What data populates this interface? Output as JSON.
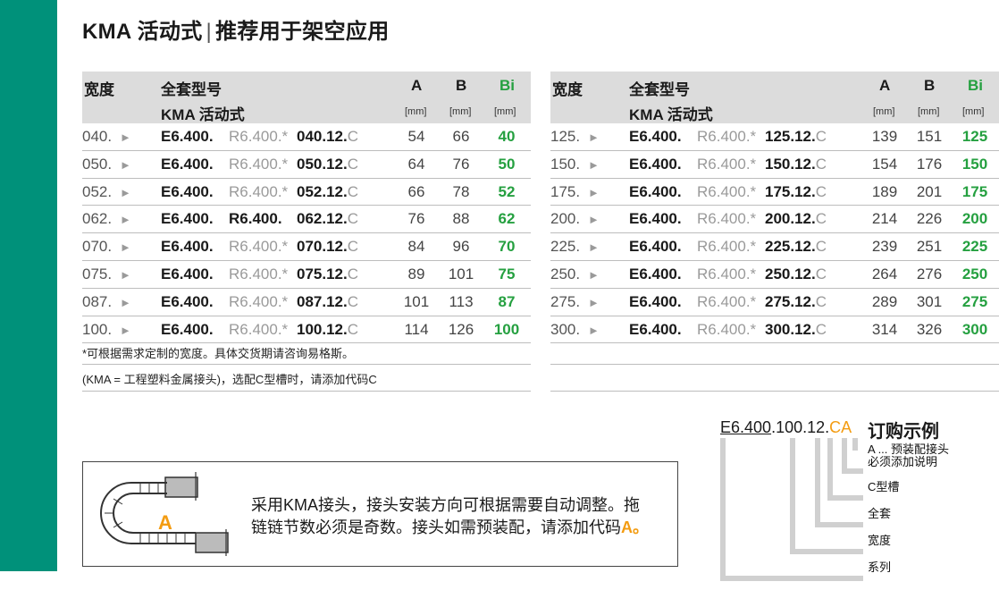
{
  "title": {
    "main": "KMA 活动式",
    "sep": "|",
    "sub": "推荐用于架空应用"
  },
  "headers": {
    "width": "宽度",
    "model": "全套型号",
    "model_sub": "KMA 活动式",
    "a": "A",
    "b": "B",
    "bi": "Bi",
    "unit": "[mm]"
  },
  "arrow": "►",
  "rows_left": [
    {
      "w": "040.",
      "e": "E6.400.",
      "r": "R6.400.*",
      "n": "040.12.",
      "c": "C",
      "a": "54",
      "b": "66",
      "bi": "40"
    },
    {
      "w": "050.",
      "e": "E6.400.",
      "r": "R6.400.*",
      "n": "050.12.",
      "c": "C",
      "a": "64",
      "b": "76",
      "bi": "50"
    },
    {
      "w": "052.",
      "e": "E6.400.",
      "r": "R6.400.*",
      "n": "052.12.",
      "c": "C",
      "a": "66",
      "b": "78",
      "bi": "52"
    },
    {
      "w": "062.",
      "e": "E6.400.",
      "r": "R6.400.",
      "n": "062.12.",
      "c": "C",
      "a": "76",
      "b": "88",
      "bi": "62"
    },
    {
      "w": "070.",
      "e": "E6.400.",
      "r": "R6.400.*",
      "n": "070.12.",
      "c": "C",
      "a": "84",
      "b": "96",
      "bi": "70"
    },
    {
      "w": "075.",
      "e": "E6.400.",
      "r": "R6.400.*",
      "n": "075.12.",
      "c": "C",
      "a": "89",
      "b": "101",
      "bi": "75"
    },
    {
      "w": "087.",
      "e": "E6.400.",
      "r": "R6.400.*",
      "n": "087.12.",
      "c": "C",
      "a": "101",
      "b": "113",
      "bi": "87"
    },
    {
      "w": "100.",
      "e": "E6.400.",
      "r": "R6.400.*",
      "n": "100.12.",
      "c": "C",
      "a": "114",
      "b": "126",
      "bi": "100"
    }
  ],
  "rows_right": [
    {
      "w": "125.",
      "e": "E6.400.",
      "r": "R6.400.*",
      "n": "125.12.",
      "c": "C",
      "a": "139",
      "b": "151",
      "bi": "125"
    },
    {
      "w": "150.",
      "e": "E6.400.",
      "r": "R6.400.*",
      "n": "150.12.",
      "c": "C",
      "a": "154",
      "b": "176",
      "bi": "150"
    },
    {
      "w": "175.",
      "e": "E6.400.",
      "r": "R6.400.*",
      "n": "175.12.",
      "c": "C",
      "a": "189",
      "b": "201",
      "bi": "175"
    },
    {
      "w": "200.",
      "e": "E6.400.",
      "r": "R6.400.*",
      "n": "200.12.",
      "c": "C",
      "a": "214",
      "b": "226",
      "bi": "200"
    },
    {
      "w": "225.",
      "e": "E6.400.",
      "r": "R6.400.*",
      "n": "225.12.",
      "c": "C",
      "a": "239",
      "b": "251",
      "bi": "225"
    },
    {
      "w": "250.",
      "e": "E6.400.",
      "r": "R6.400.*",
      "n": "250.12.",
      "c": "C",
      "a": "264",
      "b": "276",
      "bi": "250"
    },
    {
      "w": "275.",
      "e": "E6.400.",
      "r": "R6.400.*",
      "n": "275.12.",
      "c": "C",
      "a": "289",
      "b": "301",
      "bi": "275"
    },
    {
      "w": "300.",
      "e": "E6.400.",
      "r": "R6.400.*",
      "n": "300.12.",
      "c": "C",
      "a": "314",
      "b": "326",
      "bi": "300"
    }
  ],
  "notes": {
    "note1": "*可根据需求定制的宽度。具体交货期请咨询易格斯。",
    "note2": "(KMA = 工程塑料金属接头)，选配C型槽时，请添加代码C"
  },
  "box": {
    "line1": "采用KMA接头，接头安装方向可根据需要自动调整。拖",
    "line2": "链链节数必须是奇数。接头如需预装配，请添加代码",
    "code": "A",
    "end": "。",
    "diagram_label": "A"
  },
  "order": {
    "code_a": "E6.400",
    "code_b": ".100.12.",
    "code_c": "CA",
    "title": "订购示例",
    "labels": [
      "A ... 预装配接头",
      "必须添加说明",
      "C型槽",
      "全套",
      "宽度",
      "系列"
    ]
  },
  "colors": {
    "accent": "#00917a",
    "green": "#25a040",
    "orange": "#f39c12"
  }
}
